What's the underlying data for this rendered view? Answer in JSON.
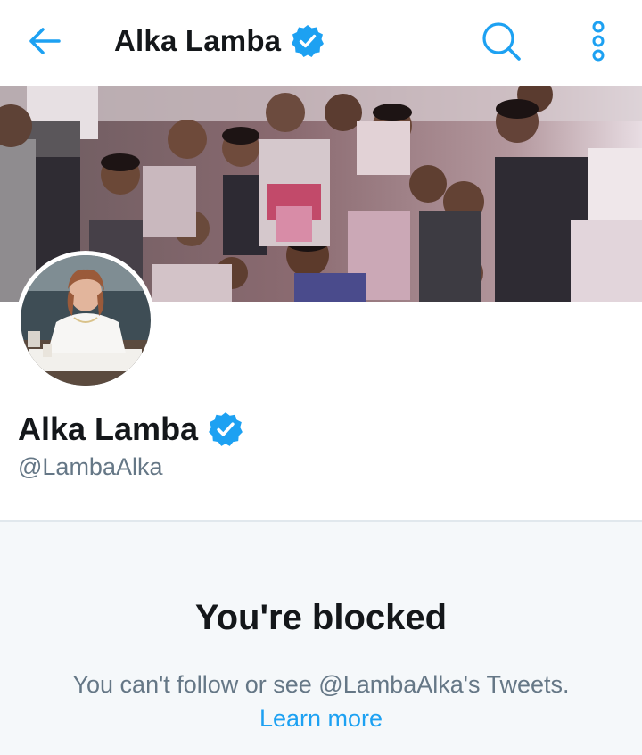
{
  "header": {
    "title": "Alka Lamba",
    "back_icon": "back-arrow-icon",
    "verified_icon": "verified-badge-icon",
    "search_icon": "search-icon",
    "more_icon": "more-vertical-icon"
  },
  "profile": {
    "name": "Alka Lamba",
    "handle": "@LambaAlka",
    "verified": true
  },
  "blocked": {
    "title": "You're blocked",
    "description": "You can't follow or see @LambaAlka's Tweets.",
    "link": "Learn more"
  },
  "colors": {
    "accent": "#1da1f2",
    "text": "#14171a",
    "muted": "#657786",
    "panel_bg": "#f5f8fa",
    "divider": "#e1e8ed"
  }
}
